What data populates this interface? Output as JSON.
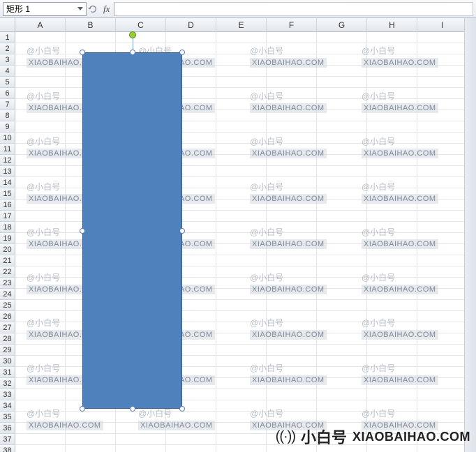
{
  "formula_bar": {
    "name_box_value": "矩形 1",
    "fx_label": "fx",
    "formula_value": ""
  },
  "columns": [
    "A",
    "B",
    "C",
    "D",
    "E",
    "F",
    "G",
    "H",
    "I"
  ],
  "row_count": 38,
  "shape": {
    "name": "矩形 1",
    "fill": "#4f81bd",
    "border": "#385d8a"
  },
  "watermark": {
    "handle": "@小白号",
    "url": "XIAOBAIHAO.COM"
  },
  "bottom_logo": {
    "icon": "((·))",
    "cn": "小白号",
    "url": "XIAOBAIHAO.COM"
  }
}
